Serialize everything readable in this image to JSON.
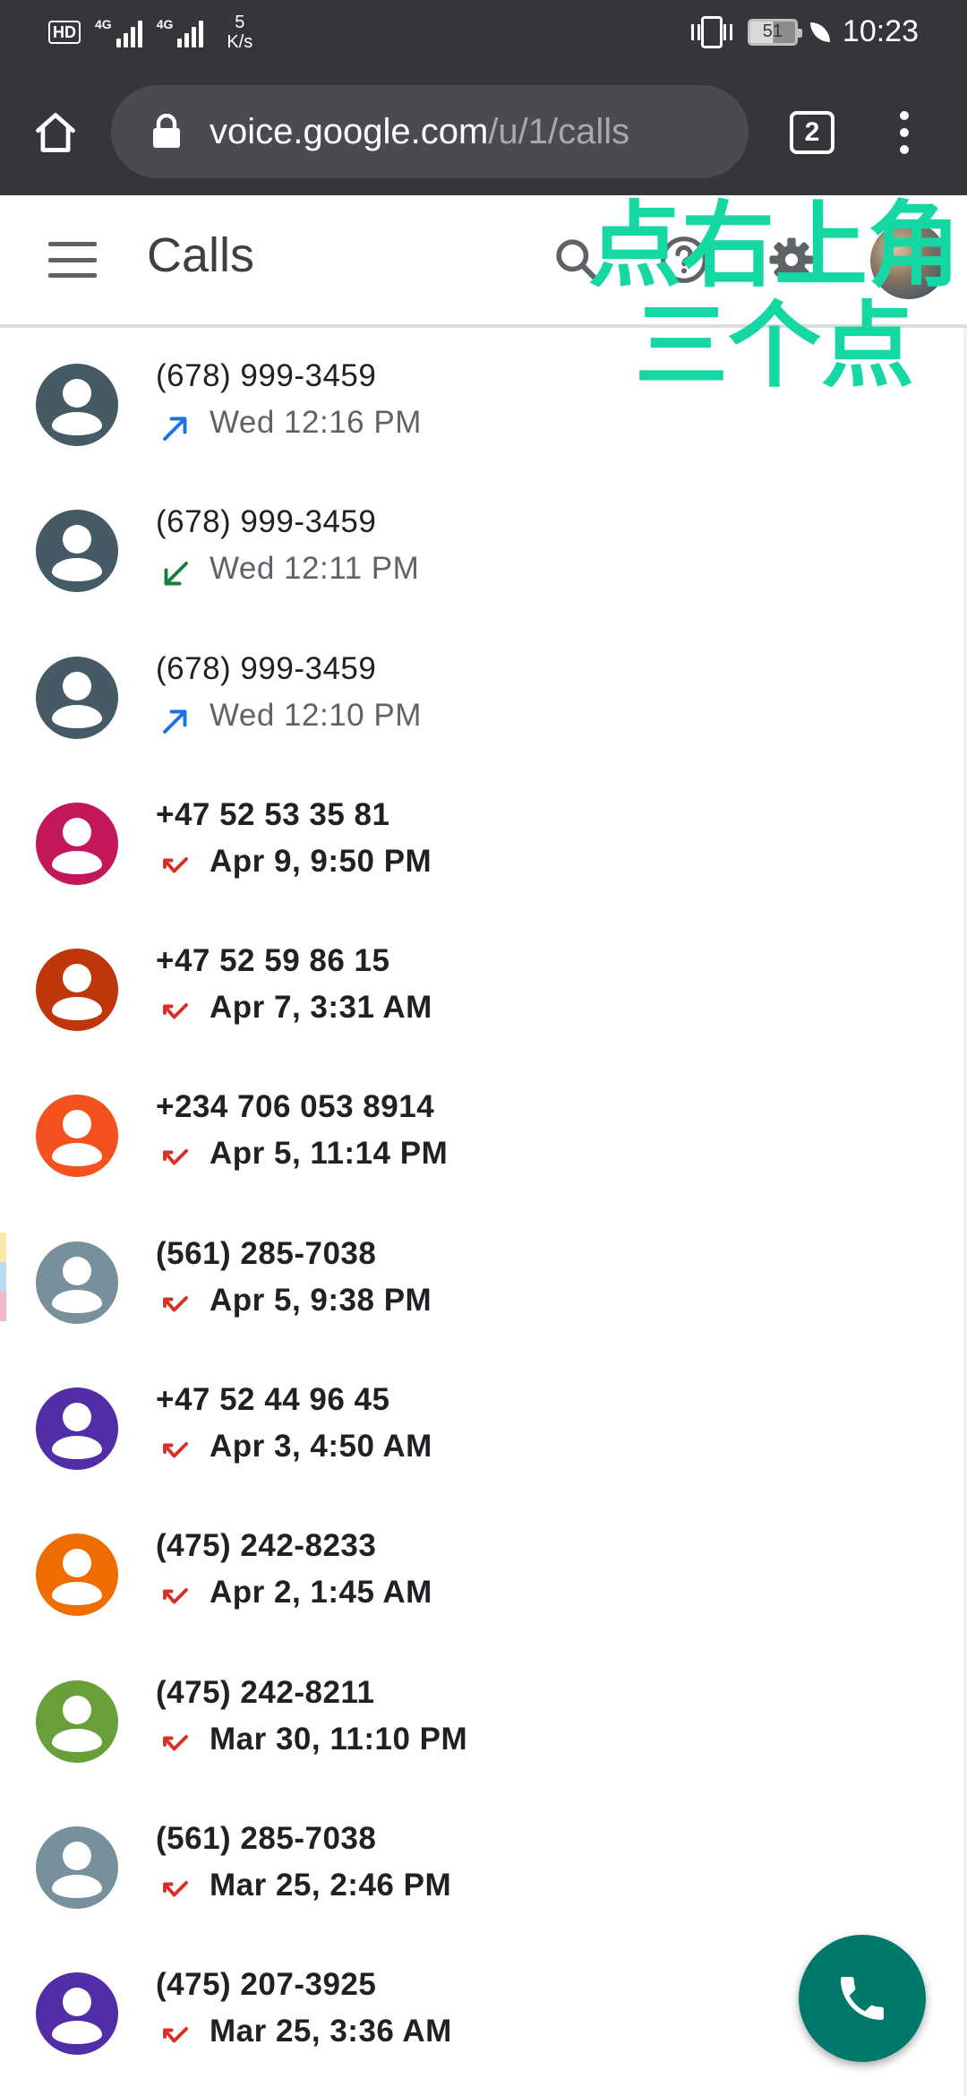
{
  "status_bar": {
    "hd": "HD",
    "net1": "4G",
    "net2": "4G",
    "speed_value": "5",
    "speed_unit": "K/s",
    "battery": "51",
    "time": "10:23"
  },
  "browser": {
    "url_host": "voice.google.com",
    "url_path": "/u/1/calls",
    "tab_count": "2"
  },
  "header": {
    "title": "Calls"
  },
  "annotation": "点右上角\n三个点",
  "calls": [
    {
      "number": "(678) 999-3459",
      "time": "Wed 12:16 PM",
      "type": "outgoing",
      "color": "#455a64",
      "missed": false
    },
    {
      "number": "(678) 999-3459",
      "time": "Wed 12:11 PM",
      "type": "incoming",
      "color": "#455a64",
      "missed": false
    },
    {
      "number": "(678) 999-3459",
      "time": "Wed 12:10 PM",
      "type": "outgoing",
      "color": "#455a64",
      "missed": false
    },
    {
      "number": "+47 52 53 35 81",
      "time": "Apr 9, 9:50 PM",
      "type": "missed",
      "color": "#c2185b",
      "missed": true
    },
    {
      "number": "+47 52 59 86 15",
      "time": "Apr 7, 3:31 AM",
      "type": "missed",
      "color": "#bf360c",
      "missed": true
    },
    {
      "number": "+234 706 053 8914",
      "time": "Apr 5, 11:14 PM",
      "type": "missed",
      "color": "#f4511e",
      "missed": true
    },
    {
      "number": "(561) 285-7038",
      "time": "Apr 5, 9:38 PM",
      "type": "missed",
      "color": "#78909c",
      "missed": true
    },
    {
      "number": "+47 52 44 96 45",
      "time": "Apr 3, 4:50 AM",
      "type": "missed",
      "color": "#512da8",
      "missed": true
    },
    {
      "number": "(475) 242-8233",
      "time": "Apr 2, 1:45 AM",
      "type": "missed",
      "color": "#ef6c00",
      "missed": true
    },
    {
      "number": "(475) 242-8211",
      "time": "Mar 30, 11:10 PM",
      "type": "missed",
      "color": "#689f38",
      "missed": true
    },
    {
      "number": "(561) 285-7038",
      "time": "Mar 25, 2:46 PM",
      "type": "missed",
      "color": "#78909c",
      "missed": true
    },
    {
      "number": "(475) 207-3925",
      "time": "Mar 25, 3:36 AM",
      "type": "missed",
      "color": "#512da8",
      "missed": true
    }
  ],
  "colors": {
    "outgoing_arrow": "#1a73e8",
    "incoming_arrow": "#188038",
    "missed_arrow": "#d93025",
    "fab": "#00796b",
    "annotation": "#15d7a4"
  },
  "icons": {
    "home": "home-icon",
    "lock": "lock-icon",
    "tabs": "tab-switcher-icon",
    "menu": "more-vert-icon",
    "hamburger": "hamburger-menu-icon",
    "search": "search-icon",
    "help": "help-icon",
    "settings": "gear-icon",
    "fab": "phone-icon"
  }
}
